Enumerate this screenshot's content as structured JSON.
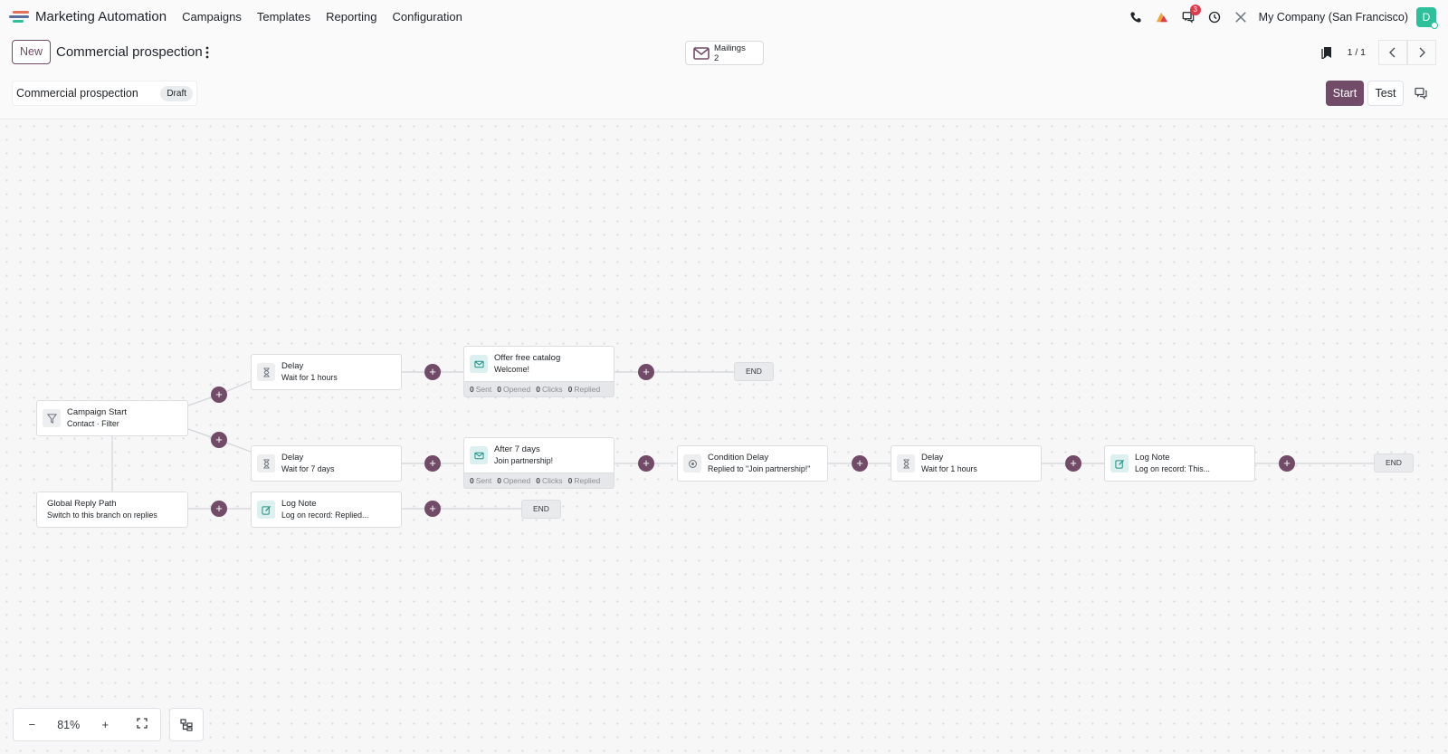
{
  "nav": {
    "app_name": "Marketing Automation",
    "menu": [
      "Campaigns",
      "Templates",
      "Reporting",
      "Configuration"
    ],
    "messages_badge": "3",
    "company": "My Company (San Francisco)",
    "avatar_initial": "D"
  },
  "control": {
    "new_label": "New",
    "title": "Commercial prospection",
    "mailings_label": "Mailings",
    "mailings_count": "2",
    "pager": "1 / 1"
  },
  "status": {
    "name": "Commercial prospection",
    "state": "Draft",
    "start_label": "Start",
    "test_label": "Test"
  },
  "workflow": {
    "campaign_start": {
      "title": "Campaign Start",
      "subtitle": "Contact · Filter"
    },
    "global_reply": {
      "title": "Global Reply Path",
      "subtitle": "Switch to this branch on replies"
    },
    "delay_1": {
      "title": "Delay",
      "subtitle": "Wait for 1 hours"
    },
    "offer": {
      "title": "Offer free catalog",
      "subtitle": "Welcome!"
    },
    "delay_2": {
      "title": "Delay",
      "subtitle": "Wait for 7 days"
    },
    "after7": {
      "title": "After 7 days",
      "subtitle": "Join partnership!"
    },
    "condition": {
      "title": "Condition Delay",
      "subtitle": "Replied to \"Join partnership!\""
    },
    "delay_3": {
      "title": "Delay",
      "subtitle": "Wait for 1 hours"
    },
    "lognote_1": {
      "title": "Log Note",
      "subtitle": "Log on record: This..."
    },
    "lognote_2": {
      "title": "Log Note",
      "subtitle": "Log on record: Replied..."
    },
    "end_label": "END",
    "add_symbol": "+",
    "stats_offer": {
      "sent": "0",
      "opened": "0",
      "clicks": "0",
      "replied": "0"
    },
    "stats_after7": {
      "sent": "0",
      "opened": "0",
      "clicks": "0",
      "replied": "0"
    },
    "stat_labels": {
      "sent": "Sent",
      "opened": "Opened",
      "clicks": "Clicks",
      "replied": "Replied"
    }
  },
  "zoom": {
    "minus": "−",
    "level": "81%",
    "plus": "+"
  },
  "colors": {
    "brand": "#714b67",
    "avatar": "#2ebf9b",
    "badge": "#e03b4b",
    "mail_icon_bg": "#dcf1ef"
  },
  "icons": {
    "phone": "phone-icon",
    "activity": "activity-icon",
    "messages": "messages-icon",
    "clock": "clock-icon",
    "tools": "tools-icon",
    "mail": "envelope-icon",
    "hourglass": "hourglass-icon",
    "filter": "filter-icon",
    "note": "edit-note-icon",
    "condition": "target-icon",
    "fullscreen": "fullscreen-icon",
    "layout": "layout-tree-icon"
  }
}
